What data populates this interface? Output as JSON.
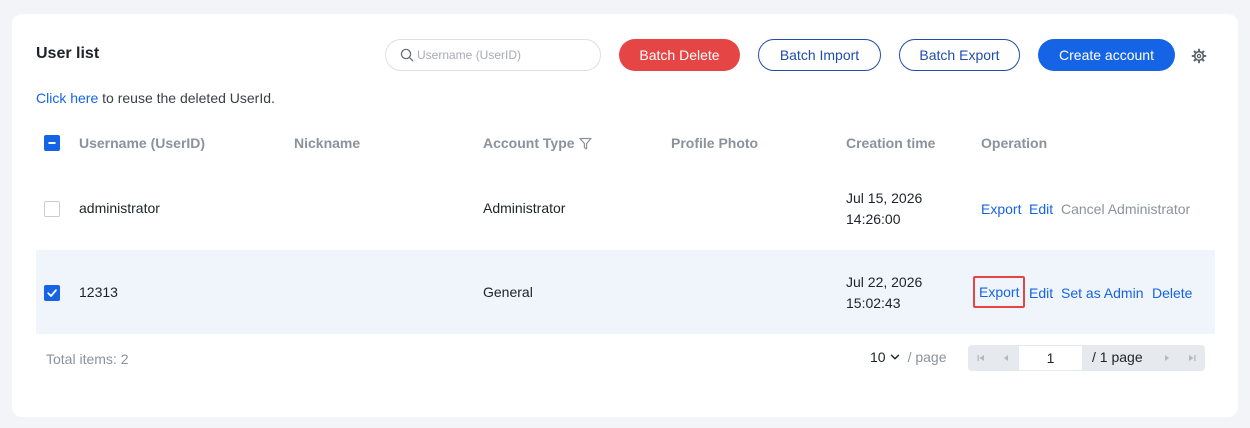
{
  "header": {
    "title": "User list",
    "search_placeholder": "Username (UserID)",
    "batch_delete": "Batch Delete",
    "batch_import": "Batch Import",
    "batch_export": "Batch Export",
    "create_account": "Create account"
  },
  "hint": {
    "link": "Click here",
    "text": " to reuse the deleted UserId."
  },
  "table": {
    "columns": [
      "Username (UserID)",
      "Nickname",
      "Account Type",
      "Profile Photo",
      "Creation time",
      "Operation"
    ],
    "rows": [
      {
        "username": "administrator",
        "nickname": "",
        "account_type": "Administrator",
        "profile_photo": "",
        "date": "Jul 15, 2026",
        "time": "14:26:00",
        "checked": false,
        "ops": [
          "Export",
          "Edit",
          "Cancel Administrator"
        ]
      },
      {
        "username": "12313",
        "nickname": "",
        "account_type": "General",
        "profile_photo": "",
        "date": "Jul 22, 2026",
        "time": "15:02:43",
        "checked": true,
        "ops": [
          "Export",
          "Edit",
          "Set as Admin",
          "Delete"
        ]
      }
    ]
  },
  "footer": {
    "total_label": "Total items:",
    "total_count": "2",
    "page_size": "10",
    "per_page": "/ page",
    "current_page": "1",
    "total_pages": "/ 1 page"
  },
  "colors": {
    "primary": "#1664e6",
    "danger": "#e54545",
    "outline": "#1f4ea8",
    "muted": "#8c929b"
  }
}
